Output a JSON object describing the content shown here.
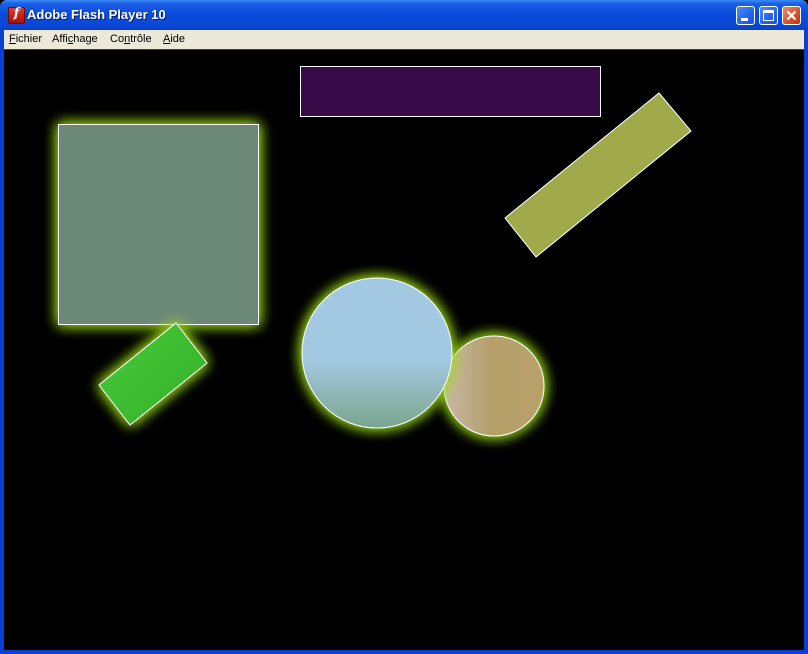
{
  "window": {
    "title": "Adobe Flash Player 10",
    "icon": "flash-player-icon",
    "buttons": [
      "minimize-icon",
      "maximize-icon",
      "close-icon"
    ]
  },
  "menu": {
    "items": [
      {
        "label": "Fichier",
        "mnemonic": "F"
      },
      {
        "label": "Affichage",
        "mnemonic": "c"
      },
      {
        "label": "Contrôle",
        "mnemonic": "n"
      },
      {
        "label": "Aide",
        "mnemonic": "A"
      }
    ]
  },
  "stage": {
    "background": "#000000",
    "glow_color": "#9bdc1e",
    "shapes": [
      {
        "name": "purple-rectangle",
        "kind": "rectangle",
        "fill": "#390a48",
        "stroke": "#ffffff",
        "glow": false
      },
      {
        "name": "olive-rotated-bar",
        "kind": "rectangle",
        "fill": "#a0aa4a",
        "stroke": "#ffffff",
        "glow": false
      },
      {
        "name": "gray-green-square",
        "kind": "square",
        "fill": "#6c8977",
        "stroke": "#ffffff",
        "glow": true
      },
      {
        "name": "green-rotated-rectangle",
        "kind": "rectangle",
        "fill": "#3fbf2e",
        "stroke": "#ffffff",
        "glow": true
      },
      {
        "name": "light-blue-circle",
        "kind": "circle",
        "fill": "#a6c9e0",
        "stroke": "#ffffff",
        "glow": true
      },
      {
        "name": "tan-circle",
        "kind": "circle",
        "fill": "#b5a06c",
        "stroke": "#ffffff",
        "glow": true
      }
    ]
  }
}
